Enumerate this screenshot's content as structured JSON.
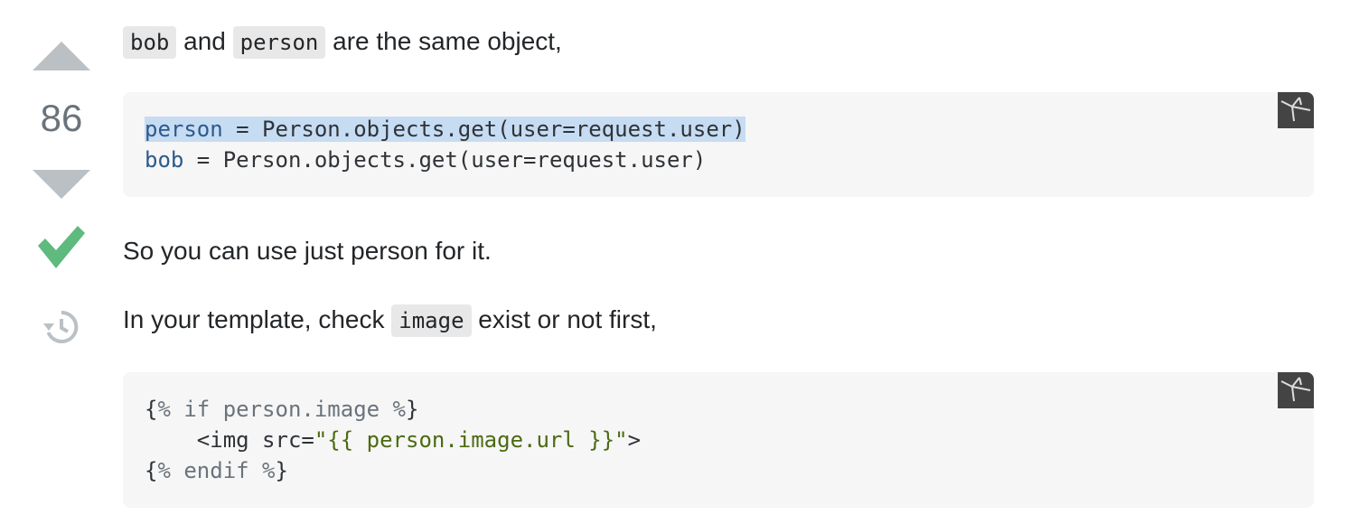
{
  "vote": {
    "count": "86",
    "upvote_icon": "arrow-up-icon",
    "downvote_icon": "arrow-down-icon",
    "accepted_icon": "checkmark-icon",
    "history_icon": "history-icon",
    "accepted_color": "#5eba7d"
  },
  "answer": {
    "para1": {
      "code1": "bob",
      "text1": " and ",
      "code2": "person",
      "text2": " are the same object,"
    },
    "code_block_1": {
      "lines": [
        {
          "var": "person",
          "rest": " = Person.objects.get(user=request.user)"
        },
        {
          "var": "bob",
          "rest": " = Person.objects.get(user=request.user)"
        }
      ]
    },
    "para2": "So you can use just person for it.",
    "para3": {
      "text1": "In your template, check ",
      "code": "image",
      "text2": " exist or not first,"
    },
    "code_block_2": {
      "line1": {
        "open": "{",
        "tag": "% if person.image %",
        "close": "}"
      },
      "line2": {
        "indent": "    <img src=",
        "str": "\"{{ person.image.url }}\"",
        "end": ">"
      },
      "line3": {
        "open": "{",
        "tag": "% endif %",
        "close": "}"
      }
    }
  }
}
